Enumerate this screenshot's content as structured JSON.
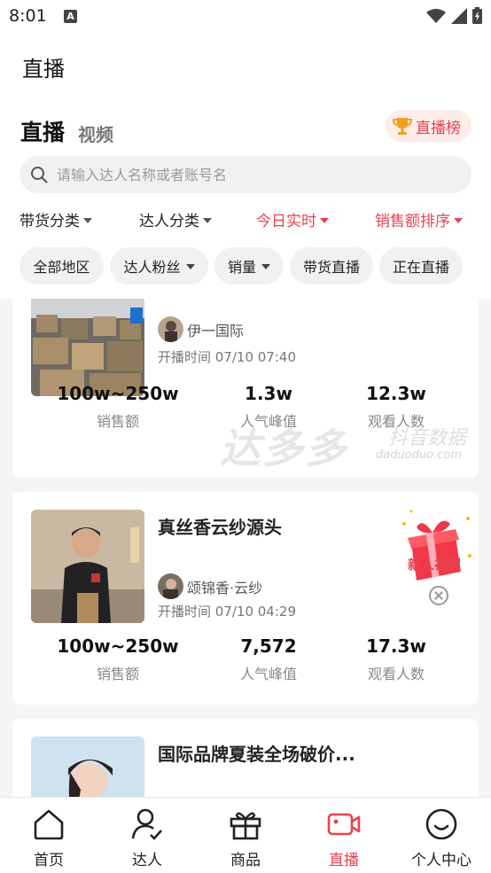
{
  "status_bar": {
    "time": "8:01"
  },
  "app_bar": {
    "title": "直播"
  },
  "content_tabs": {
    "live": "直播",
    "video": "视频",
    "rank_button": "直播榜"
  },
  "search": {
    "placeholder": "请输入达人名称或者账号名"
  },
  "filters": [
    {
      "label": "带货分类",
      "active": false
    },
    {
      "label": "达人分类",
      "active": false
    },
    {
      "label": "今日实时",
      "active": true
    },
    {
      "label": "销售额排序",
      "active": true
    }
  ],
  "chips": [
    {
      "label": "全部地区",
      "has_caret": false
    },
    {
      "label": "达人粉丝",
      "has_caret": true
    },
    {
      "label": "销量",
      "has_caret": true
    },
    {
      "label": "带货直播",
      "has_caret": false
    },
    {
      "label": "正在直播",
      "has_caret": false
    }
  ],
  "cards": [
    {
      "title": "",
      "streamer": "伊一国际",
      "start_time": "开播时间 07/10 07:40",
      "stats": [
        {
          "value": "100w~250w",
          "label": "销售额"
        },
        {
          "value": "1.3w",
          "label": "人气峰值"
        },
        {
          "value": "12.3w",
          "label": "观看人数"
        }
      ]
    },
    {
      "title": "真丝香云纱源头",
      "streamer": "颂锦香·云纱",
      "start_time": "开播时间 07/10 04:29",
      "promo_label": "新人福利",
      "stats": [
        {
          "value": "100w~250w",
          "label": "销售额"
        },
        {
          "value": "7,572",
          "label": "人气峰值"
        },
        {
          "value": "17.3w",
          "label": "观看人数"
        }
      ]
    },
    {
      "title": "国际品牌夏装全场破价...",
      "streamer": "",
      "start_time": "",
      "stats": []
    }
  ],
  "watermark": {
    "brand": "达多多",
    "tagline": "抖音数据",
    "url": "daduoduo.com"
  },
  "bottom_nav": [
    {
      "label": "首页",
      "icon": "home-icon",
      "active": false
    },
    {
      "label": "达人",
      "icon": "user-check-icon",
      "active": false
    },
    {
      "label": "商品",
      "icon": "gift-box-icon",
      "active": false
    },
    {
      "label": "直播",
      "icon": "video-camera-icon",
      "active": true
    },
    {
      "label": "个人中心",
      "icon": "smiley-icon",
      "active": false
    }
  ],
  "colors": {
    "accent": "#e8434f",
    "live_badge": "#e8438a",
    "page_bg": "#f5f5f7"
  }
}
